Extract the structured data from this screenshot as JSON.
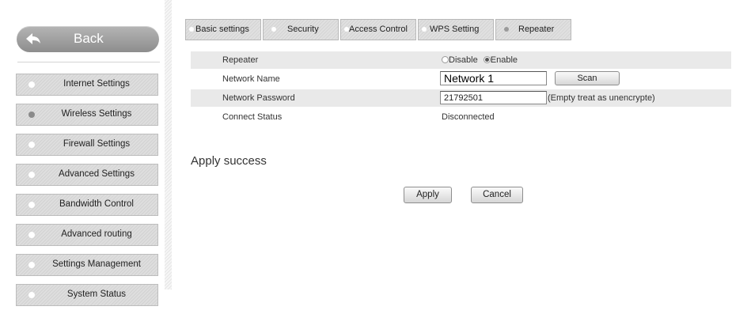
{
  "sidebar": {
    "back_label": "Back",
    "items": [
      {
        "label": "Internet Settings",
        "active": false
      },
      {
        "label": "Wireless Settings",
        "active": true
      },
      {
        "label": "Firewall Settings",
        "active": false
      },
      {
        "label": "Advanced Settings",
        "active": false
      },
      {
        "label": "Bandwidth Control",
        "active": false
      },
      {
        "label": "Advanced routing",
        "active": false
      },
      {
        "label": "Settings Management",
        "active": false
      },
      {
        "label": "System Status",
        "active": false
      }
    ]
  },
  "tabs": [
    {
      "label": "Basic settings",
      "active": false
    },
    {
      "label": "Security",
      "active": false
    },
    {
      "label": "Access Control",
      "active": false
    },
    {
      "label": "WPS Setting",
      "active": false
    },
    {
      "label": "Repeater",
      "active": true
    }
  ],
  "form": {
    "repeater": {
      "label": "Repeater",
      "options": [
        {
          "label": "Disable",
          "selected": false
        },
        {
          "label": "Enable",
          "selected": true
        }
      ]
    },
    "network_name": {
      "label": "Network Name",
      "value": "Network 1",
      "scan_label": "Scan"
    },
    "network_password": {
      "label": "Network Password",
      "value": "21792501",
      "hint": "(Empty treat as unencrypte)"
    },
    "connect_status": {
      "label": "Connect Status",
      "value": "Disconnected"
    }
  },
  "apply_message": "Apply success",
  "buttons": {
    "apply_label": "Apply",
    "cancel_label": "Cancel"
  }
}
